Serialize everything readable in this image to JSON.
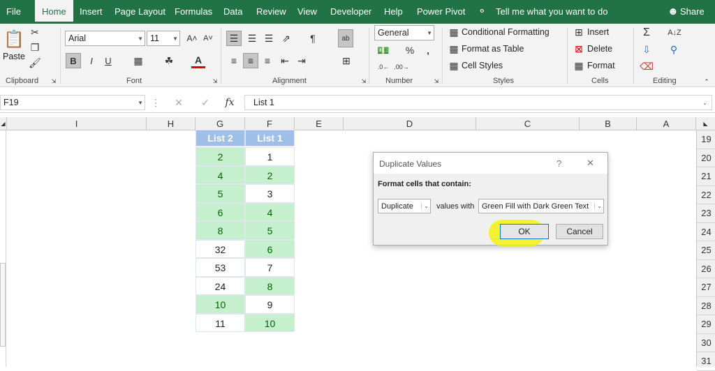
{
  "ribbon_tabs": {
    "file": "File",
    "home": "Home",
    "insert": "Insert",
    "page_layout": "Page Layout",
    "formulas": "Formulas",
    "data": "Data",
    "review": "Review",
    "view": "View",
    "developer": "Developer",
    "help": "Help",
    "power_pivot": "Power Pivot",
    "tell_me": "Tell me what you want to do",
    "share": "Share"
  },
  "clipboard": {
    "paste": "Paste",
    "label": "Clipboard"
  },
  "font": {
    "name": "Arial",
    "size": "11",
    "bold": "B",
    "italic": "I",
    "underline": "U",
    "label": "Font"
  },
  "alignment": {
    "label": "Alignment"
  },
  "number": {
    "format": "General",
    "percent": "%",
    "label": "Number"
  },
  "styles": {
    "conditional": "Conditional Formatting",
    "table": "Format as Table",
    "cell_styles": "Cell Styles",
    "label": "Styles"
  },
  "cells": {
    "insert": "Insert",
    "delete": "Delete",
    "format": "Format",
    "label": "Cells"
  },
  "editing": {
    "label": "Editing"
  },
  "formula_bar": {
    "name_box": "F19",
    "fx": "fx",
    "content": "List 1"
  },
  "columns": [
    "I",
    "H",
    "G",
    "F",
    "E",
    "D",
    "C",
    "B",
    "A"
  ],
  "rows": [
    "19",
    "20",
    "21",
    "22",
    "23",
    "24",
    "25",
    "26",
    "27",
    "28",
    "29",
    "30",
    "31"
  ],
  "table": {
    "headers": [
      "List 2",
      "List 1"
    ],
    "list2": [
      {
        "value": "2",
        "dup": true
      },
      {
        "value": "4",
        "dup": true
      },
      {
        "value": "5",
        "dup": true
      },
      {
        "value": "6",
        "dup": true
      },
      {
        "value": "8",
        "dup": true
      },
      {
        "value": "32",
        "dup": false
      },
      {
        "value": "53",
        "dup": false
      },
      {
        "value": "24",
        "dup": false
      },
      {
        "value": "10",
        "dup": true
      },
      {
        "value": "11",
        "dup": false
      }
    ],
    "list1": [
      {
        "value": "1",
        "dup": false
      },
      {
        "value": "2",
        "dup": true
      },
      {
        "value": "3",
        "dup": false
      },
      {
        "value": "4",
        "dup": true
      },
      {
        "value": "5",
        "dup": true
      },
      {
        "value": "6",
        "dup": true
      },
      {
        "value": "7",
        "dup": false
      },
      {
        "value": "8",
        "dup": true
      },
      {
        "value": "9",
        "dup": false
      },
      {
        "value": "10",
        "dup": true
      }
    ]
  },
  "dialog": {
    "title": "Duplicate Values",
    "help": "?",
    "close": "✕",
    "instruction": "Format cells that contain:",
    "type_value": "Duplicate",
    "values_with": "values with",
    "format_value": "Green Fill with Dark Green Text",
    "ok": "OK",
    "cancel": "Cancel"
  },
  "colors": {
    "excel_green": "#217346",
    "dup_fill": "#c6efce",
    "dup_text": "#006100",
    "header_fill": "#9fbfe8",
    "highlight": "#f2f200"
  }
}
